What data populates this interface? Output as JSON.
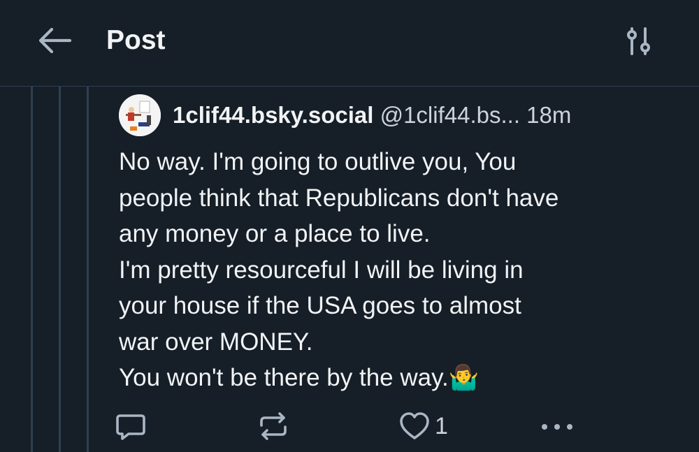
{
  "header": {
    "title": "Post",
    "back_icon": "arrow-left-icon",
    "settings_icon": "sliders-icon"
  },
  "post": {
    "author_handle": "1clif44.bsky.social",
    "author_at": "@1clif44.bs...",
    "time": "18m",
    "body_lines": [
      "No way. I'm going to outlive you, You",
      "people think that Republicans don't have",
      "any money or a place to live.",
      "I'm pretty resourceful I will be living in",
      "your house if the USA goes to almost",
      "war over MONEY.",
      "You won't be there by the way.🤷‍♂️"
    ]
  },
  "actions": {
    "reply_icon": "reply-bubble-icon",
    "repost_icon": "repost-icon",
    "like_icon": "heart-icon",
    "like_count": "1",
    "more_icon": "more-dots-icon"
  },
  "colors": {
    "background": "#161e27",
    "divider": "#2e4052",
    "text_primary": "#f1f3f5",
    "text_secondary": "#ccd3dc",
    "icon": "#a9b6c4"
  }
}
